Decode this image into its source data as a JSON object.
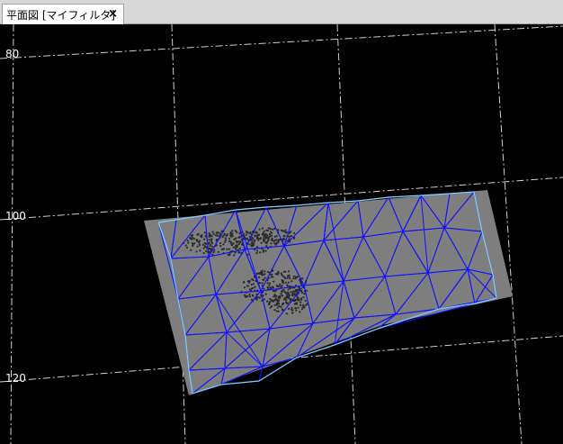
{
  "tab": {
    "title": "平面図 [マイフィルタ]",
    "close_glyph": "×"
  },
  "axis": {
    "y_labels": [
      "80",
      "100",
      "120"
    ]
  },
  "colors": {
    "background": "#000000",
    "grid": "#d0d0d0",
    "surface": "#7e7e7e",
    "mesh": "#1010ff",
    "outline": "#7fd4ff",
    "points": "#2a2a2a"
  }
}
